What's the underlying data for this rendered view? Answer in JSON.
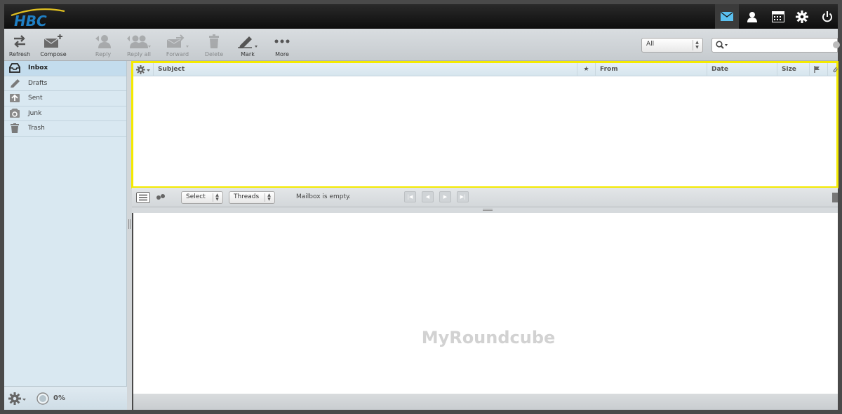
{
  "header": {
    "logo_text": "HBC",
    "icons": [
      "mail-icon",
      "contacts-icon",
      "calendar-icon",
      "settings-icon",
      "logout-icon"
    ]
  },
  "toolbar": {
    "refresh": "Refresh",
    "compose": "Compose",
    "reply": "Reply",
    "reply_all": "Reply all",
    "forward": "Forward",
    "delete": "Delete",
    "mark": "Mark",
    "more": "More"
  },
  "filter": {
    "value": "All"
  },
  "search": {
    "value": ""
  },
  "sidebar": {
    "folders": [
      {
        "label": "Inbox",
        "icon": "inbox-icon",
        "selected": true
      },
      {
        "label": "Drafts",
        "icon": "pencil-icon"
      },
      {
        "label": "Sent",
        "icon": "sent-icon"
      },
      {
        "label": "Junk",
        "icon": "junk-icon"
      },
      {
        "label": "Trash",
        "icon": "trash-icon"
      }
    ],
    "quota": "0%"
  },
  "message_list": {
    "columns": {
      "subject": "Subject",
      "flag": "★",
      "from": "From",
      "date": "Date",
      "size": "Size"
    }
  },
  "list_footer": {
    "select": "Select",
    "threads": "Threads",
    "status": "Mailbox is empty."
  },
  "preview": {
    "brand": "MyRoundcube"
  },
  "colors": {
    "highlight": "#f4ea00",
    "sidebar": "#d9e8f1",
    "header": "#0d0d0d"
  }
}
